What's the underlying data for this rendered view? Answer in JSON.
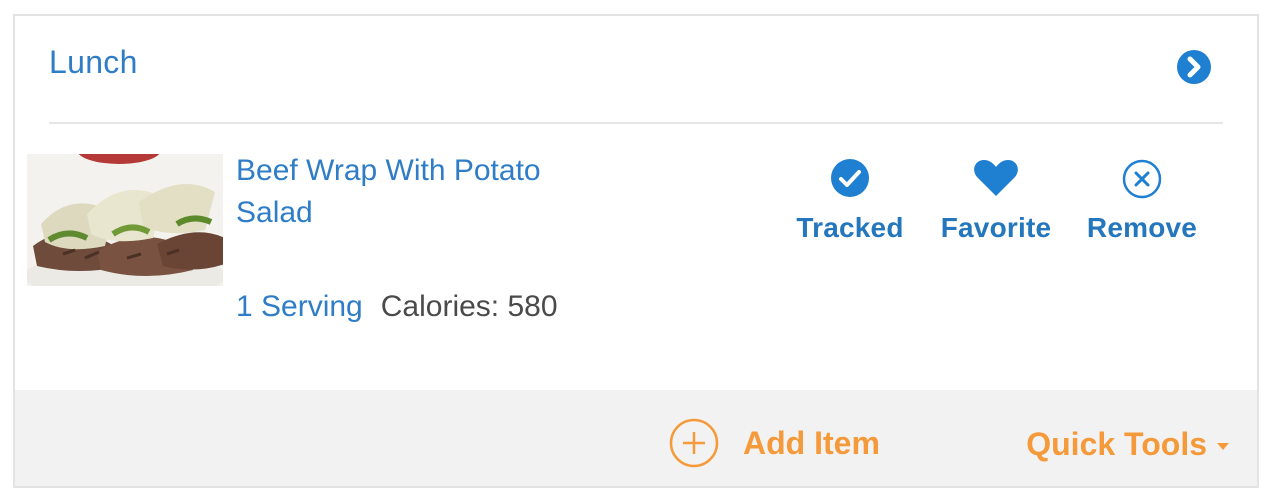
{
  "meal": {
    "title": "Lunch",
    "expand_icon": "chevron-right-circle-icon"
  },
  "item": {
    "name": "Beef Wrap With Potato Salad",
    "serving": "1 Serving",
    "calories_label": "Calories:",
    "calories_value": "580",
    "image": "beef-wrap-photo"
  },
  "actions": [
    {
      "label": "Tracked",
      "icon": "check-circle-icon"
    },
    {
      "label": "Favorite",
      "icon": "heart-icon"
    },
    {
      "label": "Remove",
      "icon": "close-circle-icon"
    }
  ],
  "footer": {
    "add_item": "Add Item",
    "add_icon": "plus-circle-icon",
    "quick_tools": "Quick Tools"
  },
  "colors": {
    "link_blue": "#2f7dc7",
    "action_blue": "#1f7fd1",
    "accent_orange": "#f59a3a"
  }
}
